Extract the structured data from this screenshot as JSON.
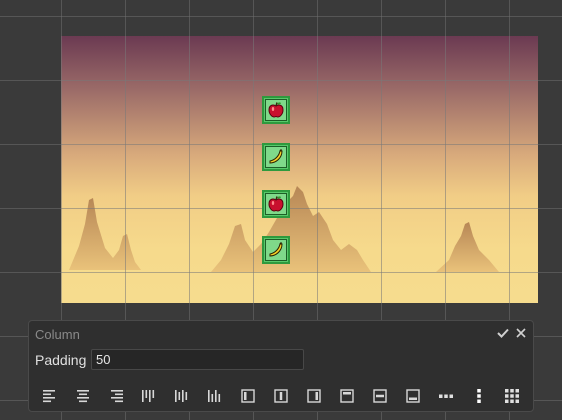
{
  "panel": {
    "title": "Column",
    "padding_label": "Padding",
    "padding_value": "50"
  },
  "scene": {
    "items": [
      "apple",
      "banana",
      "apple",
      "banana"
    ]
  },
  "toolbar": {
    "buttons": [
      "align-left-icon",
      "align-center-icon",
      "align-right-icon",
      "distribute-top-icon",
      "distribute-middle-icon",
      "distribute-bottom-icon",
      "anchor-left-icon",
      "anchor-center-icon",
      "anchor-right-icon",
      "anchor-top-icon",
      "anchor-middle-icon",
      "anchor-bottom-icon",
      "row-layout-icon",
      "column-layout-icon",
      "grid-layout-icon"
    ]
  },
  "colors": {
    "accent_green": "#58c86a",
    "panel_bg": "#2f2f2f",
    "sky_top": "#6b3a52",
    "sand": "#f6dc8e"
  }
}
